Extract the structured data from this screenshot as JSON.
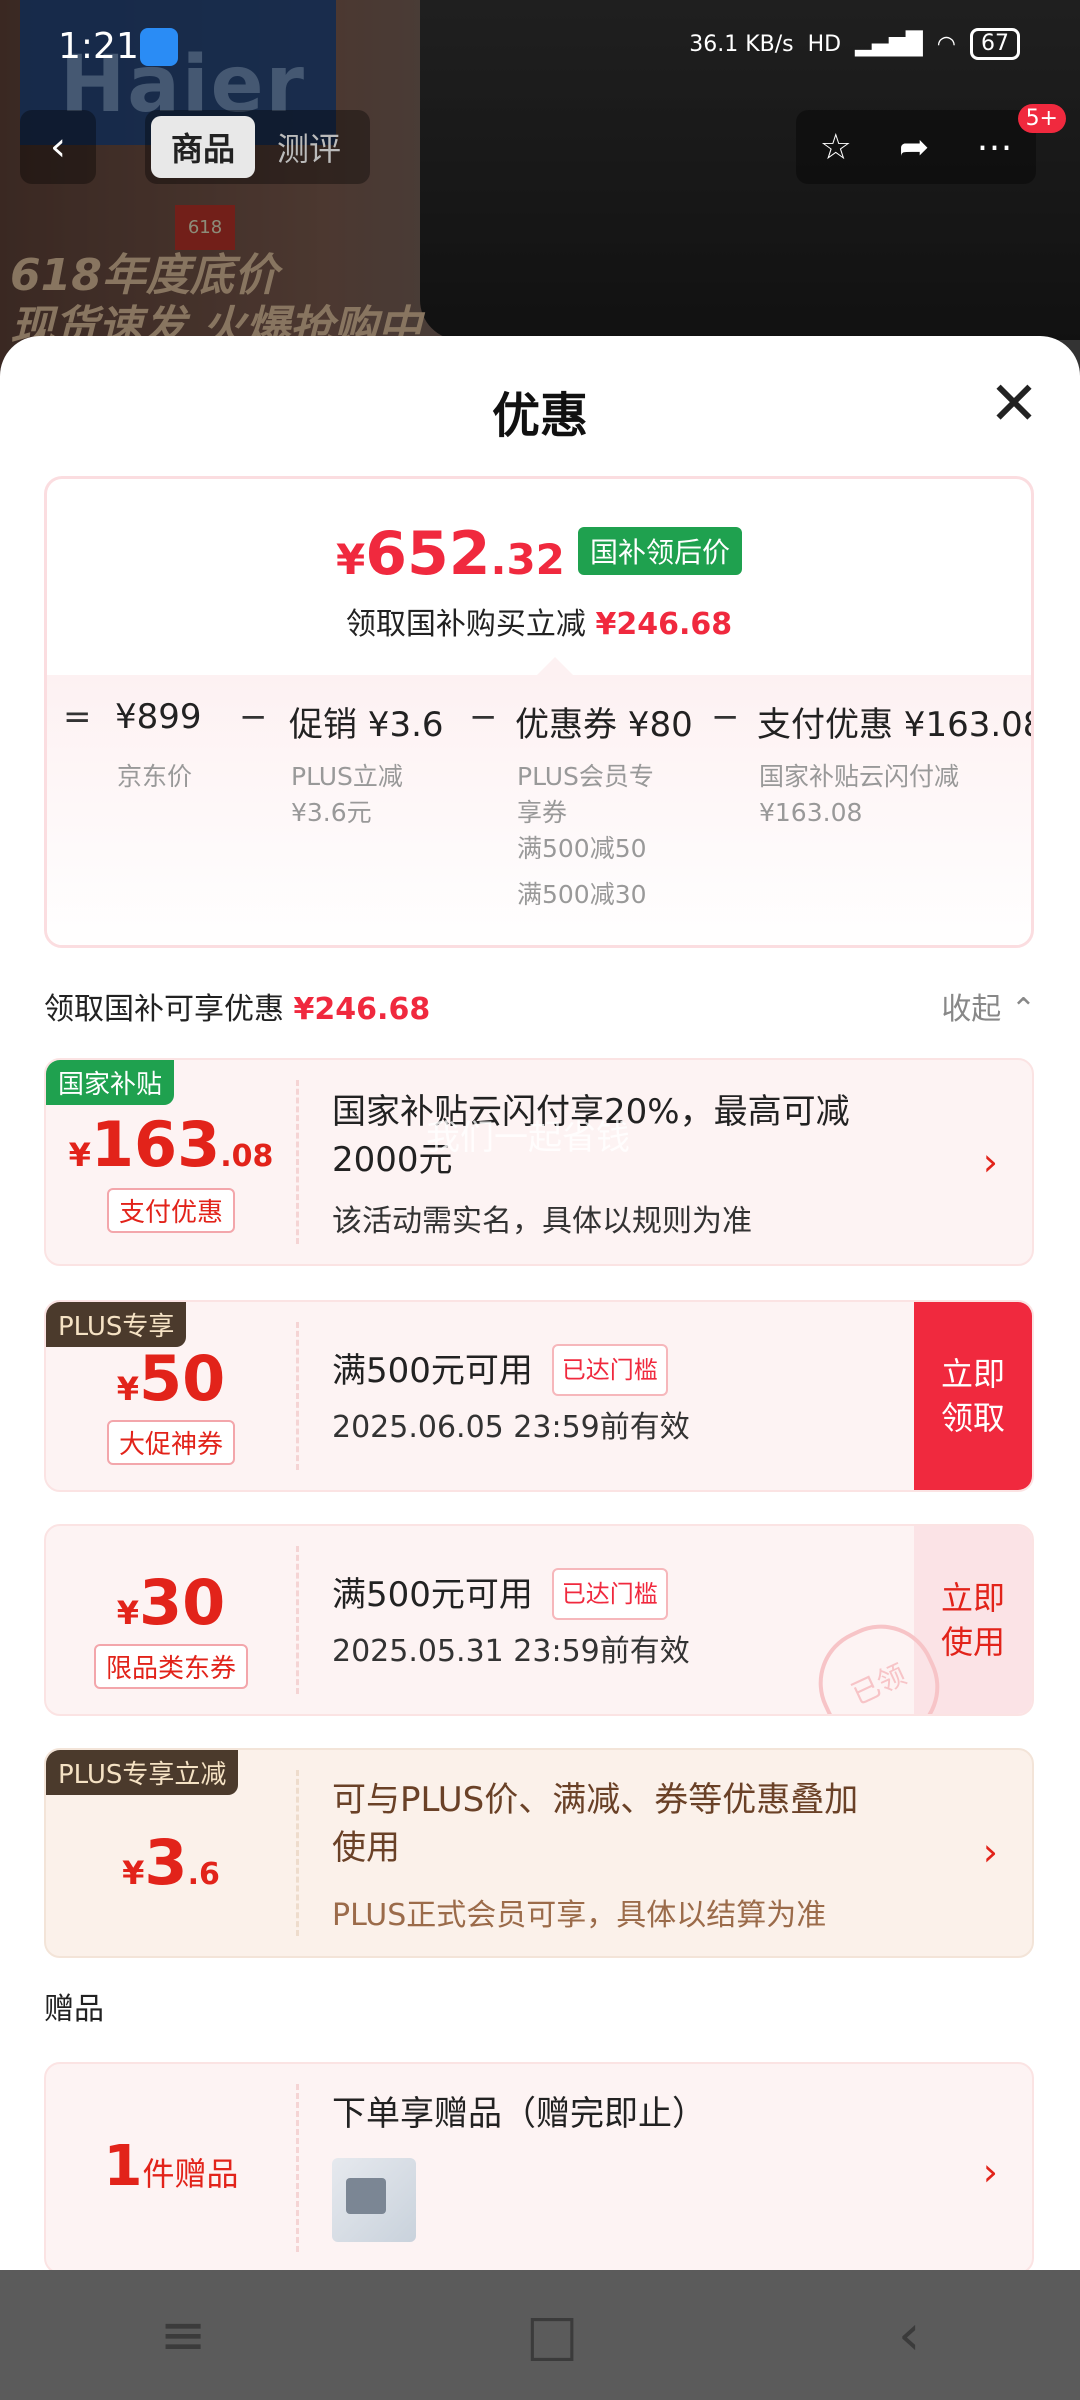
{
  "status_bar": {
    "time": "1:21",
    "net_speed": "36.1 KB/s",
    "hd": "HD",
    "battery": "67"
  },
  "hero": {
    "brand": "Haier",
    "promo_line1": "618年度底价",
    "promo_line2": "现货速发 火爆抢购中",
    "badge": "618"
  },
  "top_nav": {
    "tab_goods": "商品",
    "tab_review": "测评",
    "badge": "5+"
  },
  "sheet": {
    "title": "优惠",
    "close_icon": "close-icon"
  },
  "summary": {
    "yen": "¥",
    "price_int": "652",
    "price_dec": ".32",
    "after_tag": "国补领后价",
    "sub_text": "领取国补购买立减",
    "sub_amount": "¥246.68",
    "formula": {
      "eq": "=",
      "jd_price": "¥899",
      "jd_label": "京东价",
      "minus": "−",
      "promo": "促销 ¥3.6",
      "promo_sub1": "PLUS立减",
      "promo_sub2": "¥3.6元",
      "coupon": "优惠券 ¥80",
      "coupon_sub1": "PLUS会员专",
      "coupon_sub2": "享券",
      "coupon_sub3": "满500减50",
      "coupon_sub4": "满500减30",
      "pay": "支付优惠 ¥163.08",
      "pay_sub1": "国家补贴云闪付减",
      "pay_sub2": "¥163.08"
    }
  },
  "section": {
    "label": "领取国补可享优惠",
    "amount": "¥246.68",
    "collapse": "收起"
  },
  "cards": [
    {
      "corner": "国家补贴",
      "yen": "¥",
      "big": "163",
      "dec": ".08",
      "pill": "支付优惠",
      "title_line1": "国家补贴云闪付享20%，最高可减",
      "title_line2": "2000元",
      "watermark": "我们一起省钱",
      "desc": "该活动需实名，具体以规则为准"
    },
    {
      "corner": "PLUS专享",
      "yen": "¥",
      "big": "50",
      "pill": "大促神券",
      "title": "满500元可用",
      "tag": "已达门槛",
      "desc": "2025.06.05 23:59前有效",
      "cta1": "立即",
      "cta2": "领取"
    },
    {
      "yen": "¥",
      "big": "30",
      "pill": "限品类东券",
      "title": "满500元可用",
      "tag": "已达门槛",
      "desc": "2025.05.31 23:59前有效",
      "cta1": "立即",
      "cta2": "使用",
      "stamp": "已领"
    },
    {
      "corner": "PLUS专享立减",
      "yen": "¥",
      "big": "3",
      "dec": ".6",
      "title_line1": "可与PLUS价、满减、券等优惠叠加",
      "title_line2": "使用",
      "desc": "PLUS正式会员可享，具体以结算为准"
    }
  ],
  "gift": {
    "section_label": "赠品",
    "count": "1",
    "unit": "件赠品",
    "title": "下单享赠品（赠完即止）"
  },
  "sysnav": {
    "menu": "≡",
    "home": "□",
    "back": "‹"
  }
}
